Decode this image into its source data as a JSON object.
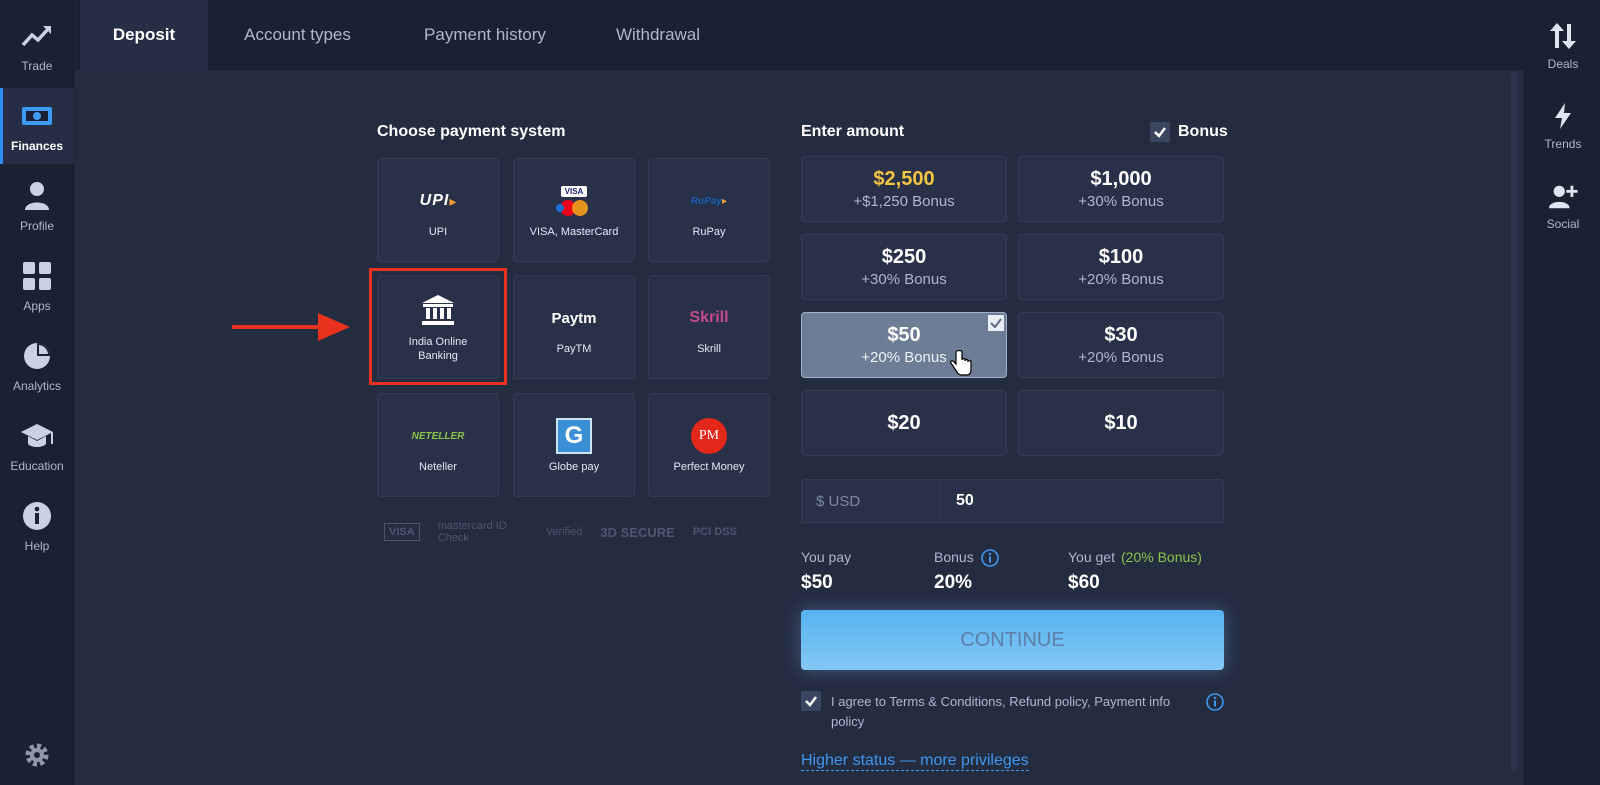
{
  "left_nav": [
    {
      "label": "Trade",
      "icon": "trend-up-icon"
    },
    {
      "label": "Finances",
      "icon": "wallet-icon"
    },
    {
      "label": "Profile",
      "icon": "user-icon"
    },
    {
      "label": "Apps",
      "icon": "grid-icon"
    },
    {
      "label": "Analytics",
      "icon": "pie-chart-icon"
    },
    {
      "label": "Education",
      "icon": "graduation-cap-icon"
    },
    {
      "label": "Help",
      "icon": "info-icon"
    }
  ],
  "right_nav": [
    {
      "label": "Deals",
      "icon": "arrows-updown-icon"
    },
    {
      "label": "Trends",
      "icon": "lightning-icon"
    },
    {
      "label": "Social",
      "icon": "add-user-icon"
    }
  ],
  "tabs": [
    {
      "label": "Deposit",
      "active": true
    },
    {
      "label": "Account types"
    },
    {
      "label": "Payment history"
    },
    {
      "label": "Withdrawal"
    }
  ],
  "payment": {
    "title": "Choose payment system",
    "methods": [
      {
        "label": "UPI",
        "logo": "UPI"
      },
      {
        "label": "VISA, MasterCard",
        "logo": "VISA"
      },
      {
        "label": "RuPay",
        "logo": "RuPay"
      },
      {
        "label": "India Online Banking",
        "logo": "bank"
      },
      {
        "label": "PayTM",
        "logo": "Paytm"
      },
      {
        "label": "Skrill",
        "logo": "Skrill"
      },
      {
        "label": "Neteller",
        "logo": "NETELLER"
      },
      {
        "label": "Globe pay",
        "logo": "G"
      },
      {
        "label": "Perfect Money",
        "logo": "PM"
      }
    ],
    "security_logos": [
      "VISA",
      "mastercard ID Check",
      "Verified",
      "3D SECURE",
      "PCI DSS"
    ]
  },
  "amount": {
    "title": "Enter amount",
    "bonus_label": "Bonus",
    "presets": [
      {
        "value": "$2,500",
        "bonus": "+$1,250 Bonus"
      },
      {
        "value": "$1,000",
        "bonus": "+30% Bonus"
      },
      {
        "value": "$250",
        "bonus": "+30% Bonus"
      },
      {
        "value": "$100",
        "bonus": "+20% Bonus"
      },
      {
        "value": "$50",
        "bonus": "+20% Bonus"
      },
      {
        "value": "$30",
        "bonus": "+20% Bonus"
      },
      {
        "value": "$20",
        "bonus": ""
      },
      {
        "value": "$10",
        "bonus": ""
      }
    ],
    "currency_prefix": "$ USD",
    "input_value": "50"
  },
  "summary": {
    "you_pay_label": "You pay",
    "you_pay_value": "$50",
    "bonus_label": "Bonus",
    "bonus_value": "20%",
    "you_get_label": "You get",
    "you_get_note": "(20% Bonus)",
    "you_get_value": "$60"
  },
  "continue_label": "CONTINUE",
  "terms_text": "I agree to Terms & Conditions, Refund policy, Payment info policy",
  "higher_status_link": "Higher status — more privileges",
  "colors": {
    "accent_blue": "#2f8ef5",
    "gold": "#f4c542",
    "bonus_green": "#8bc34a",
    "highlight_red": "#e8321e"
  }
}
